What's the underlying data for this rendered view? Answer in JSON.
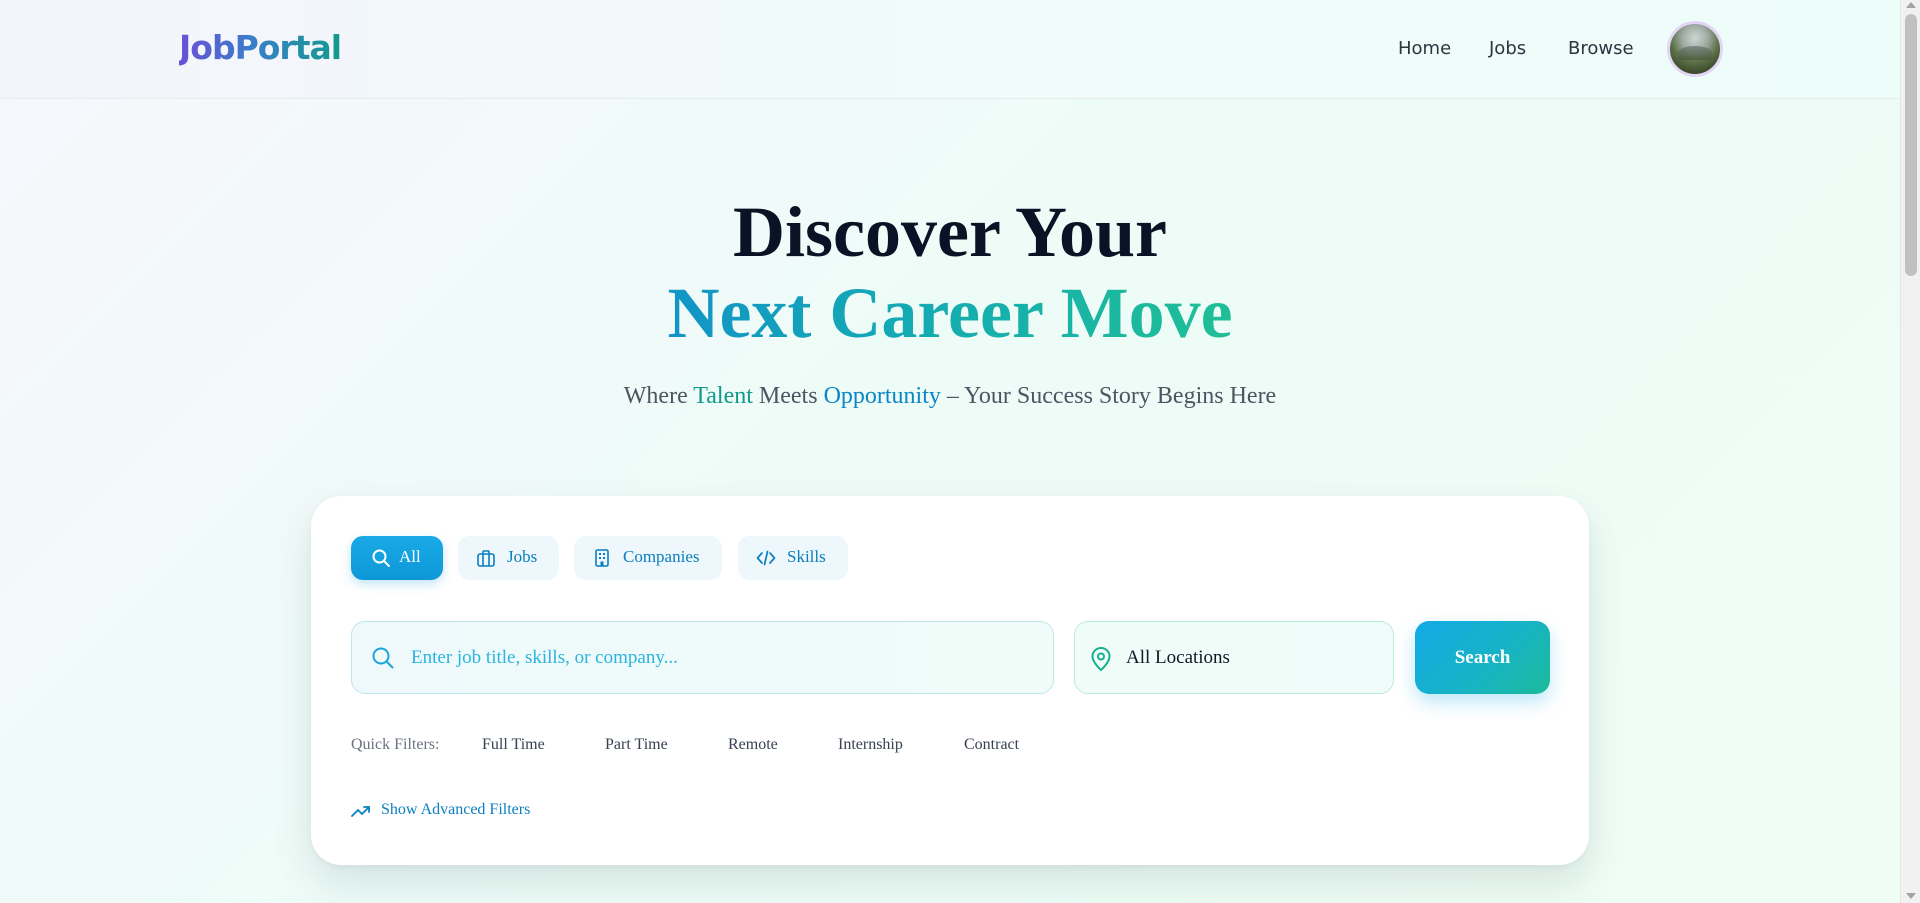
{
  "header": {
    "logo": "JobPortal",
    "nav": [
      {
        "label": "Home"
      },
      {
        "label": "Jobs"
      },
      {
        "label": "Browse"
      }
    ],
    "avatar_icon": "user-avatar"
  },
  "hero": {
    "title_line1": "Discover Your",
    "title_line2": "Next Career Move",
    "tagline": {
      "part1": "Where ",
      "talent": "Talent",
      "part2": " Meets ",
      "opportunity": "Opportunity",
      "part3": " – Your Success Story Begins Here"
    }
  },
  "search": {
    "tabs": [
      {
        "label": "All",
        "icon": "search-icon",
        "active": true
      },
      {
        "label": "Jobs",
        "icon": "briefcase-icon",
        "active": false
      },
      {
        "label": "Companies",
        "icon": "building-icon",
        "active": false
      },
      {
        "label": "Skills",
        "icon": "code-icon",
        "active": false
      }
    ],
    "query_value": "",
    "query_placeholder": "Enter job title, skills, or company...",
    "location_value": "All Locations",
    "button_label": "Search",
    "quick_filters_label": "Quick Filters:",
    "quick_filters": [
      "Full Time",
      "Part Time",
      "Remote",
      "Internship",
      "Contract"
    ],
    "advanced_label": "Show Advanced Filters"
  },
  "colors": {
    "accent_blue": "#0d97d8",
    "accent_teal": "#1fbf96",
    "heading_dark": "#0a1226"
  }
}
